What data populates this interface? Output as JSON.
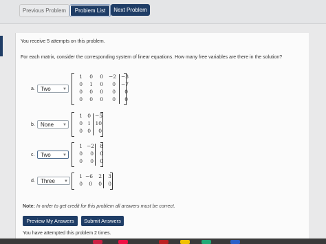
{
  "nav": {
    "previous": "Previous Problem",
    "list": "Problem List",
    "next": "Next Problem"
  },
  "attempts_text": "You receive 5 attempts on this problem.",
  "question": "For each matrix, consider the corresponding system of linear equations. How many free variables are there in the solution?",
  "problems": [
    {
      "label": "a.",
      "answer": "Two",
      "matrix": [
        [
          "1",
          "0",
          "0",
          "−2",
          "−3"
        ],
        [
          "0",
          "1",
          "0",
          "0",
          "−7"
        ],
        [
          "0",
          "0",
          "0",
          "0",
          "0"
        ],
        [
          "0",
          "0",
          "0",
          "0",
          "0"
        ]
      ]
    },
    {
      "label": "b.",
      "answer": "None",
      "matrix": [
        [
          "1",
          "0",
          "−5"
        ],
        [
          "0",
          "1",
          "10"
        ],
        [
          "0",
          "0",
          "0"
        ]
      ]
    },
    {
      "label": "c.",
      "answer": "Two",
      "matrix": [
        [
          "1",
          "−2",
          "8"
        ],
        [
          "0",
          "0",
          "0"
        ],
        [
          "0",
          "0",
          "0"
        ]
      ]
    },
    {
      "label": "d.",
      "answer": "Three",
      "matrix": [
        [
          "1",
          "−6",
          "2",
          "3"
        ],
        [
          "0",
          "0",
          "0",
          "0"
        ]
      ]
    }
  ],
  "note_bold": "Note:",
  "note_rest": " In order to get credit for this problem all answers must be correct.",
  "buttons": {
    "preview": "Preview My Answers",
    "submit": "Submit Answers"
  },
  "attempted_text": "You have attempted this problem 2 times."
}
